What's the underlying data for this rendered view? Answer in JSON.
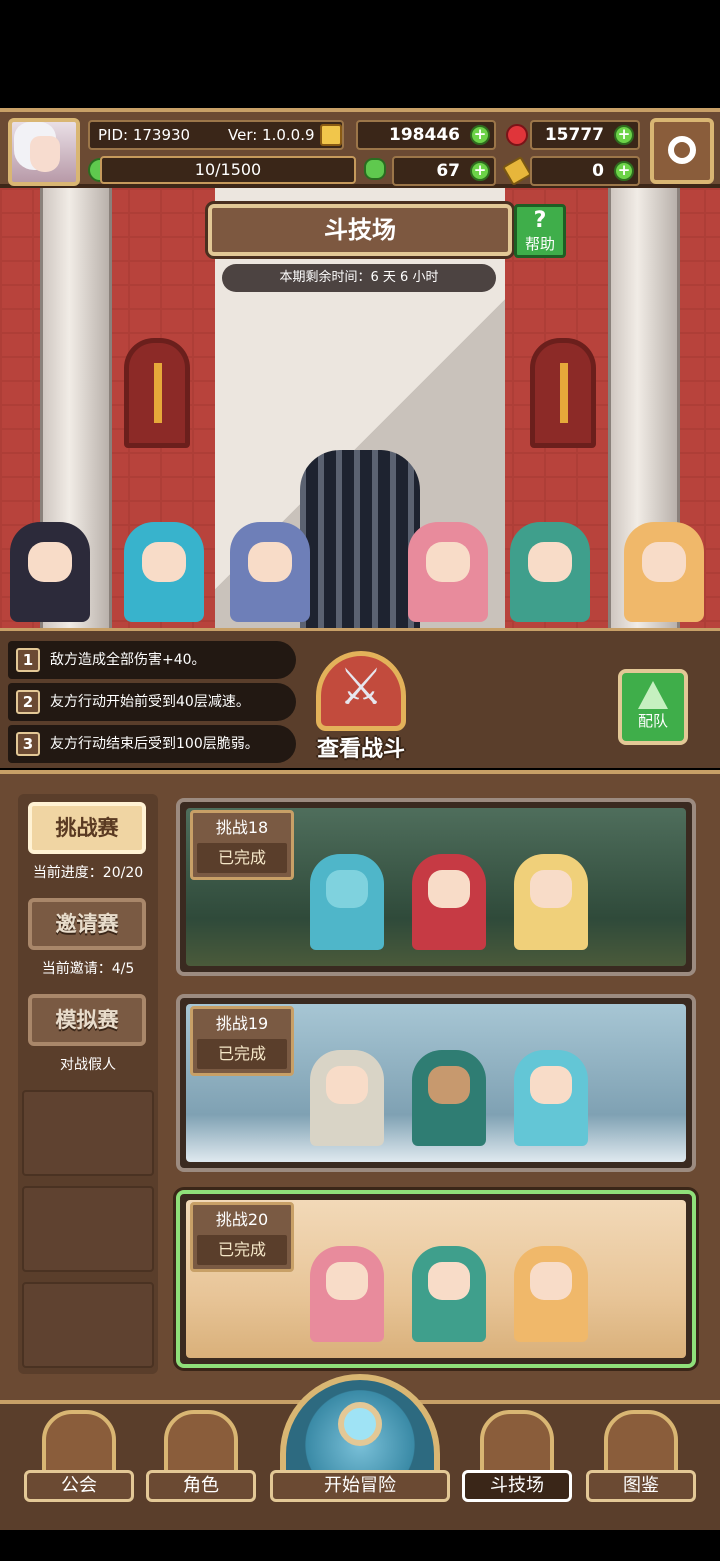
{
  "topbar": {
    "pid": "PID: 173930",
    "version": "Ver: 1.0.0.9",
    "stamina": "10/1500",
    "gold": "198446",
    "gems": "15777",
    "clover": "67",
    "key": "0"
  },
  "arena": {
    "title": "斗技场",
    "help_label": "帮助",
    "time_left": "本期剩余时间：6 天 6 小时"
  },
  "buffs": [
    {
      "num": "1",
      "text": "敌方造成全部伤害+40。"
    },
    {
      "num": "2",
      "text": "友方行动开始前受到40层减速。"
    },
    {
      "num": "3",
      "text": "友方行动结束后受到100层脆弱。"
    }
  ],
  "view_battle_label": "查看战斗",
  "team_label": "配队",
  "modes": [
    {
      "label": "挑战赛",
      "sub": "当前进度：20/20"
    },
    {
      "label": "邀请赛",
      "sub": "当前邀请：4/5"
    },
    {
      "label": "模拟赛",
      "sub": "对战假人"
    }
  ],
  "challenges": [
    {
      "name": "挑战18",
      "status": "已完成"
    },
    {
      "name": "挑战19",
      "status": "已完成"
    },
    {
      "name": "挑战20",
      "status": "已完成"
    }
  ],
  "nav": {
    "guild": "公会",
    "characters": "角色",
    "adventure": "开始冒险",
    "arena": "斗技场",
    "codex": "图鉴"
  }
}
